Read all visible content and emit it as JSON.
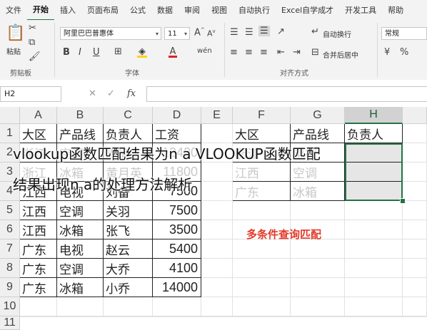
{
  "menu": [
    "文件",
    "开始",
    "插入",
    "页面布局",
    "公式",
    "数据",
    "审阅",
    "视图",
    "自动执行",
    "Excel自学成才",
    "开发工具",
    "帮助"
  ],
  "ribbon": {
    "paste_label": "粘贴",
    "font_name": "阿里巴巴普惠体",
    "font_size": "11",
    "wrap_text": "自动换行",
    "merge_center": "合并后居中",
    "number_format": "常规",
    "clipboard_label": "剪贴板",
    "font_label": "字体",
    "alignment_label": "对齐方式",
    "icons": [
      "paste-icon",
      "cut-icon",
      "copy-icon",
      "format-painter-icon",
      "bold-icon",
      "italic-icon",
      "underline-icon"
    ]
  },
  "formula_bar": {
    "name_box": "H2",
    "fx": "fx"
  },
  "columns": [
    "A",
    "B",
    "C",
    "D",
    "E",
    "F",
    "G",
    "H"
  ],
  "rows": [
    "1",
    "2",
    "3",
    "4",
    "5",
    "6",
    "7",
    "8",
    "9",
    "10",
    "11"
  ],
  "headers": [
    "大区",
    "产品线",
    "负责人",
    "工资"
  ],
  "table": [
    [
      "浙江",
      "空调",
      "周瑜",
      "12400"
    ],
    [
      "浙江",
      "冰箱",
      "黄月英",
      "11800"
    ],
    [
      "江西",
      "电视",
      "刘备",
      "7500"
    ],
    [
      "江西",
      "空调",
      "关羽",
      "7500"
    ],
    [
      "江西",
      "冰箱",
      "张飞",
      "3500"
    ],
    [
      "广东",
      "电视",
      "赵云",
      "5400"
    ],
    [
      "广东",
      "空调",
      "大乔",
      "4100"
    ],
    [
      "广东",
      "冰箱",
      "小乔",
      "14000"
    ]
  ],
  "lookup_headers": [
    "大区",
    "产品线",
    "负责人"
  ],
  "lookup_rows": [
    [
      "浙江",
      "电视",
      ""
    ],
    [
      "江西",
      "空调",
      ""
    ],
    [
      "广东",
      "冰箱",
      ""
    ]
  ],
  "annotation": "多条件查询匹配",
  "overlay_title_1": "vlookup函数匹配结果为n a   VLOOKUP函数匹配",
  "overlay_title_2": "结果出现n a的处理方法解析"
}
